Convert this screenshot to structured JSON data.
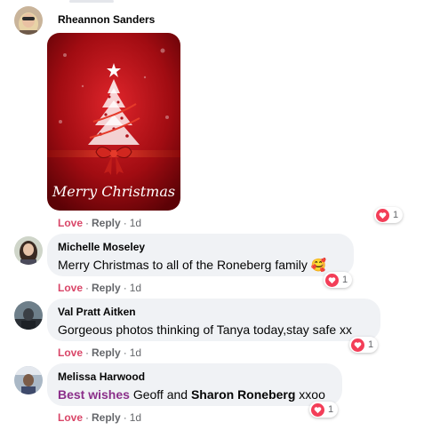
{
  "comments": [
    {
      "author": "Rheannon Sanders",
      "image": {
        "greeting": "Merry Christmas"
      },
      "actions": {
        "love": "Love",
        "reply": "Reply",
        "time": "1d"
      },
      "reaction": {
        "type": "heart-icon",
        "count": "1"
      }
    },
    {
      "author": "Michelle Moseley",
      "text": "Merry Christmas to all of the Roneberg family 🥰",
      "actions": {
        "love": "Love",
        "reply": "Reply",
        "time": "1d"
      },
      "reaction": {
        "type": "heart-icon",
        "count": "1"
      }
    },
    {
      "author": "Val Pratt Aitken",
      "text": "Gorgeous photos thinking of Tanya today,stay safe xx",
      "actions": {
        "love": "Love",
        "reply": "Reply",
        "time": "1d"
      },
      "reaction": {
        "type": "heart-icon",
        "count": "1"
      }
    },
    {
      "author": "Melissa Harwood",
      "text_parts": [
        "Best wishes",
        " Geoff and ",
        "Sharon Roneberg",
        " xxoo"
      ],
      "actions": {
        "love": "Love",
        "reply": "Reply",
        "time": "1d"
      },
      "reaction": {
        "type": "heart-icon",
        "count": "1"
      }
    }
  ],
  "colors": {
    "love": "#d94668",
    "heart": "#f33e58",
    "bubble": "#f0f2f5",
    "highlight_text": "#8b2f8a"
  }
}
